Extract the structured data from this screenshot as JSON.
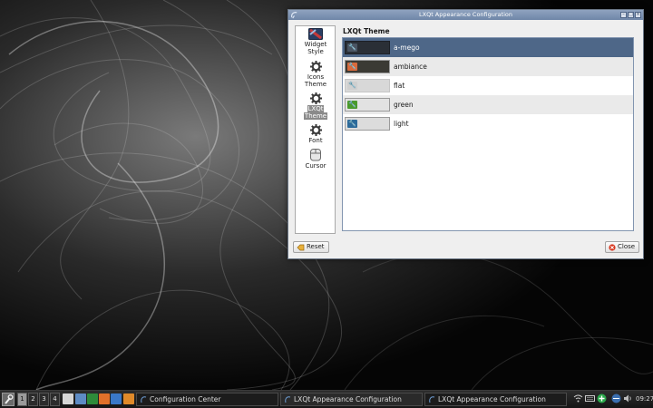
{
  "window": {
    "title": "LXQt Appearance Configuration"
  },
  "sidebar": {
    "items": [
      {
        "line1": "Widget",
        "line2": "Style",
        "icon": "widget-style-icon"
      },
      {
        "line1": "Icons",
        "line2": "Theme",
        "icon": "gear-icon"
      },
      {
        "line1": "LXQt",
        "line2": "Theme",
        "icon": "gear-icon",
        "selected": true
      },
      {
        "line1": "Font",
        "line2": "",
        "icon": "gear-icon"
      },
      {
        "line1": "Cursor",
        "line2": "",
        "icon": "cursor-icon"
      }
    ]
  },
  "content": {
    "title": "LXQt Theme",
    "themes": [
      {
        "name": "a-mego",
        "preview_bg": "#2a2f36",
        "chip": "#4a5563"
      },
      {
        "name": "ambiance",
        "preview_bg": "#3b3a34",
        "chip": "#d86a3c"
      },
      {
        "name": "flat",
        "preview_bg": "#d8d8d8",
        "chip": "#cfcfcf"
      },
      {
        "name": "green",
        "preview_bg": "#e2e2e2",
        "chip": "#4a9a2c"
      },
      {
        "name": "light",
        "preview_bg": "#dcdcdc",
        "chip": "#2c6a9a"
      }
    ],
    "selected_index": 0
  },
  "buttons": {
    "reset": "Reset",
    "close": "Close"
  },
  "taskbar": {
    "desktops": [
      "1",
      "2",
      "3",
      "4"
    ],
    "active_desktop": 0,
    "tasks": [
      {
        "label": "Configuration Center"
      },
      {
        "label": "LXQt Appearance Configuration"
      },
      {
        "label": "LXQt Appearance Configuration"
      }
    ],
    "clock": "09:27"
  },
  "colors": {
    "accent": "#4e6788",
    "titlebar": "#7d93b4"
  }
}
